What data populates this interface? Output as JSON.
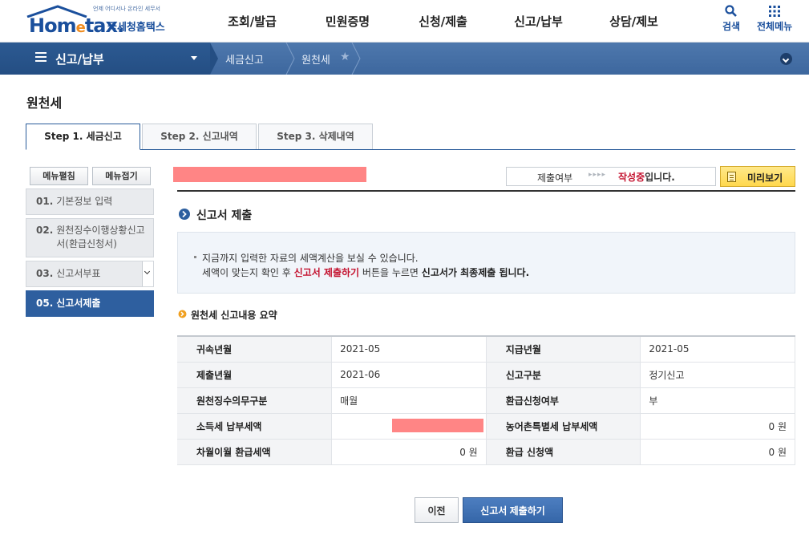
{
  "header": {
    "logo_small": "언제 어디서나 온라인 세무서",
    "logo_main_pre": "Hom",
    "logo_main_e": "e",
    "logo_main_post": "tax",
    "logo_kr": "국세청홈택스",
    "nav": [
      "조회/발급",
      "민원증명",
      "신청/제출",
      "신고/납부",
      "상담/제보"
    ],
    "search_label": "검색",
    "allmenu_label": "전체메뉴",
    "brand_color": "#1a4f9c"
  },
  "location": {
    "main": "신고/납부",
    "crumb1": "세금신고",
    "crumb2": "원천세"
  },
  "page_title": "원천세",
  "tabs": [
    "Step 1. 세금신고",
    "Step 2. 신고내역",
    "Step 3. 삭제내역"
  ],
  "side": {
    "expand_label": "메뉴펼침",
    "collapse_label": "메뉴접기",
    "items": [
      {
        "num": "01.",
        "label": "기본정보 입력"
      },
      {
        "num": "02.",
        "label": "원천징수이행상황신고서(환급신청서)"
      },
      {
        "num": "03.",
        "label": "신고서부표"
      },
      {
        "num": "05.",
        "label": "신고서제출"
      }
    ]
  },
  "status": {
    "label": "제출여부",
    "arrows": "▸▸▸▸",
    "value_red": "작성중",
    "value_rest": "입니다.",
    "preview_label": "미리보기"
  },
  "submit_section": {
    "title": "신고서 제출",
    "notice_line1": "지금까지 입력한 자료의 세액계산을 보실 수 있습니다.",
    "notice_line2_a": "세액이 맞는지 확인 후 ",
    "notice_line2_hl": "신고서 제출하기",
    "notice_line2_b": " 버튼을 누르면 ",
    "notice_line2_bold": "신고서가 최종제출 됩니다."
  },
  "summary": {
    "title": "원천세 신고내용 요약",
    "rows": [
      {
        "l1": "귀속년월",
        "v1": "2021-05",
        "l2": "지급년월",
        "v2": "2021-05"
      },
      {
        "l1": "제출년월",
        "v1": "2021-06",
        "l2": "신고구분",
        "v2": "정기신고"
      },
      {
        "l1": "원천징수의무구분",
        "v1": "매월",
        "l2": "환급신청여부",
        "v2": "부"
      },
      {
        "l1": "소득세 납부세액",
        "v1": "",
        "l2": "농어촌특별세 납부세액",
        "v2": "0 원"
      },
      {
        "l1": "차월이월 환급세액",
        "v1": "0 원",
        "l2": "환급 신청액",
        "v2": "0 원"
      }
    ]
  },
  "buttons": {
    "prev": "이전",
    "submit": "신고서 제출하기"
  }
}
